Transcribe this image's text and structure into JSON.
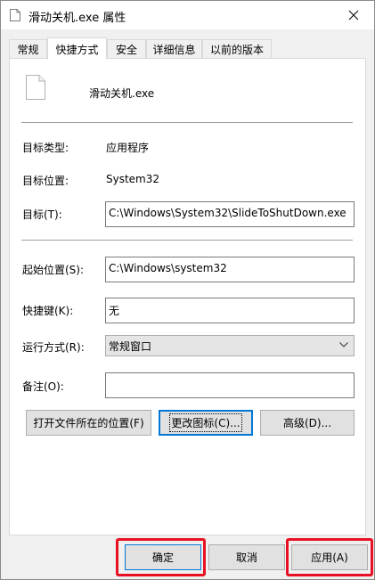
{
  "window": {
    "title": "滑动关机.exe 属性",
    "close_glyph": "✕"
  },
  "tabs": [
    {
      "label": "常规"
    },
    {
      "label": "快捷方式",
      "active": true
    },
    {
      "label": "安全"
    },
    {
      "label": "详细信息"
    },
    {
      "label": "以前的版本"
    }
  ],
  "header": {
    "file_name": "滑动关机.exe"
  },
  "fields": {
    "target_type_label": "目标类型:",
    "target_type_value": "应用程序",
    "target_location_label": "目标位置:",
    "target_location_value": "System32",
    "target_label": "目标(T):",
    "target_value": "C:\\Windows\\System32\\SlideToShutDown.exe",
    "start_in_label": "起始位置(S):",
    "start_in_value": "C:\\Windows\\system32",
    "shortcut_key_label": "快捷键(K):",
    "shortcut_key_value": "无",
    "run_label": "运行方式(R):",
    "run_value": "常规窗口",
    "comment_label": "备注(O):",
    "comment_value": ""
  },
  "buttons": {
    "open_location": "打开文件所在的位置(F)",
    "change_icon": "更改图标(C)...",
    "advanced": "高级(D)..."
  },
  "footer": {
    "ok": "确定",
    "cancel": "取消",
    "apply": "应用(A)"
  },
  "colors": {
    "highlight": "#e81123",
    "focus": "#0078d7"
  }
}
